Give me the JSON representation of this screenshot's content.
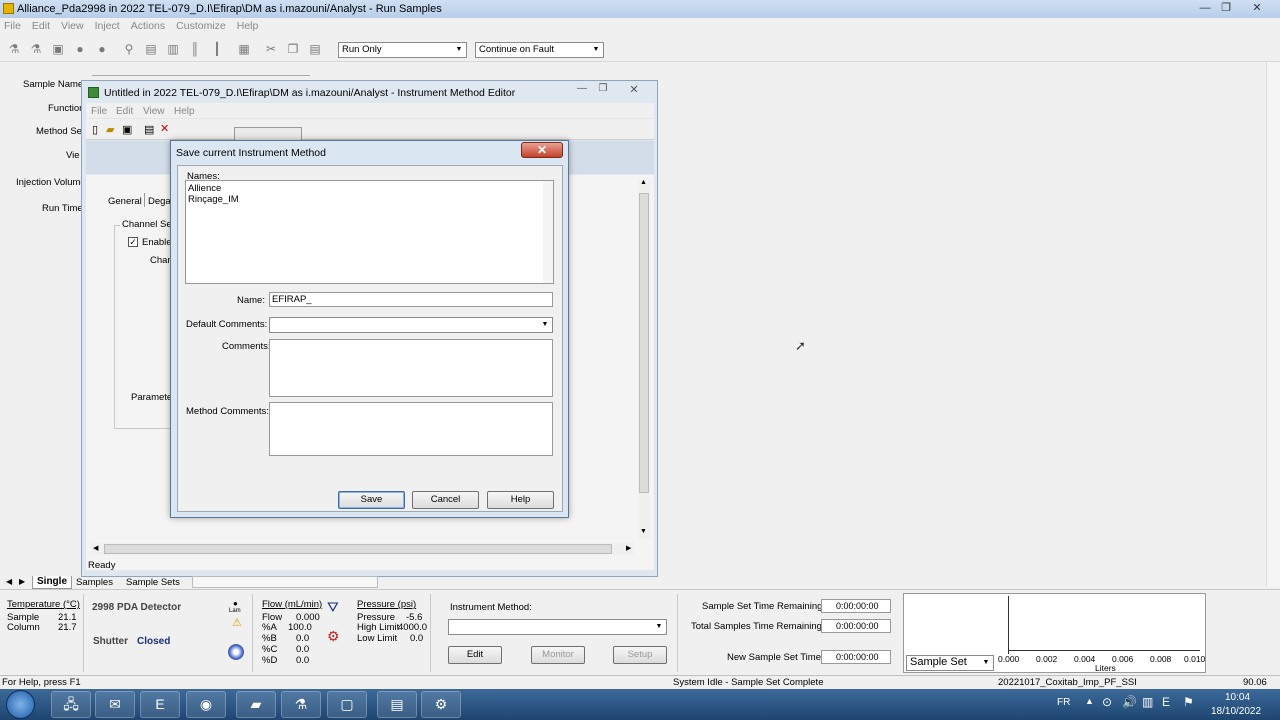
{
  "app": {
    "title": "Alliance_Pda2998 in 2022 TEL-079_D.I\\Efirap\\DM as i.mazouni/Analyst - Run Samples",
    "menu": [
      "File",
      "Edit",
      "View",
      "Inject",
      "Actions",
      "Customize",
      "Help"
    ],
    "run_mode": "Run Only",
    "fault_mode": "Continue on Fault"
  },
  "left_labels": {
    "sample_name": "Sample Name",
    "function": "Function",
    "method_set": "Method Se",
    "view": "Vie",
    "injection_volume": "Injection Volume",
    "run_time": "Run Time"
  },
  "ime": {
    "title": "Untitled in 2022 TEL-079_D.I\\Efirap\\DM as i.mazouni/Analyst - Instrument Method Editor",
    "menu": [
      "File",
      "Edit",
      "View",
      "Help"
    ],
    "tab_general": "General",
    "tab_degas": "Dega",
    "channel_group": "Channel Se",
    "enable_label": "Enable",
    "channel_label": "Chann",
    "parameters_label": "Paramete",
    "status": "Ready"
  },
  "dialog": {
    "title": "Save current Instrument Method",
    "names_label": "Names:",
    "names": [
      "Allience",
      "Rinçage_IM"
    ],
    "name_label": "Name:",
    "name_value": "EFIRAP_",
    "default_comments_label": "Default Comments:",
    "comments_label": "Comments:",
    "method_comments_label": "Method Comments:",
    "save": "Save",
    "cancel": "Cancel",
    "help": "Help"
  },
  "tabs": [
    "Single",
    "Samples",
    "Sample Sets"
  ],
  "temperature": {
    "header": "Temperature (°C)",
    "rows": [
      {
        "label": "Sample",
        "value": "21.1"
      },
      {
        "label": "Column",
        "value": "21.7"
      }
    ]
  },
  "detector": {
    "name": "2998 PDA Detector",
    "lamp": "Lam",
    "shutter_label": "Shutter",
    "shutter_value": "Closed"
  },
  "flow": {
    "header": "Flow (mL/min)",
    "rows": [
      {
        "label": "Flow",
        "value": "0.000"
      },
      {
        "label": "%A",
        "value": "100.0"
      },
      {
        "label": "%B",
        "value": "0.0"
      },
      {
        "label": "%C",
        "value": "0.0"
      },
      {
        "label": "%D",
        "value": "0.0"
      }
    ]
  },
  "pressure": {
    "header": "Pressure (psi)",
    "rows": [
      {
        "label": "Pressure",
        "value": "-5.6"
      },
      {
        "label": "High Limit",
        "value": "4000.0"
      },
      {
        "label": "Low Limit",
        "value": "0.0"
      }
    ]
  },
  "instrument_method": {
    "label": "Instrument Method:",
    "edit": "Edit",
    "monitor": "Monitor",
    "setup": "Setup"
  },
  "times": {
    "set_remaining_label": "Sample Set Time Remaining",
    "set_remaining": "0:00:00:00",
    "total_remaining_label": "Total Samples Time Remaining",
    "total_remaining": "0:00:00:00",
    "new_set_label": "New Sample Set Time",
    "new_set": "0:00:00:00"
  },
  "gauge": {
    "select": "Sample Set",
    "ticks": [
      "0.000",
      "0.002",
      "0.004",
      "0.006",
      "0.008",
      "0.010"
    ],
    "unit": "Liters"
  },
  "statusbar": {
    "help": "For Help, press F1",
    "state": "System Idle - Sample Set Complete",
    "project": "20221017_Coxitab_Imp_PF_SSI",
    "zoom": "90.06"
  },
  "tray": {
    "lang": "FR",
    "time": "10:04",
    "date": "18/10/2022"
  }
}
